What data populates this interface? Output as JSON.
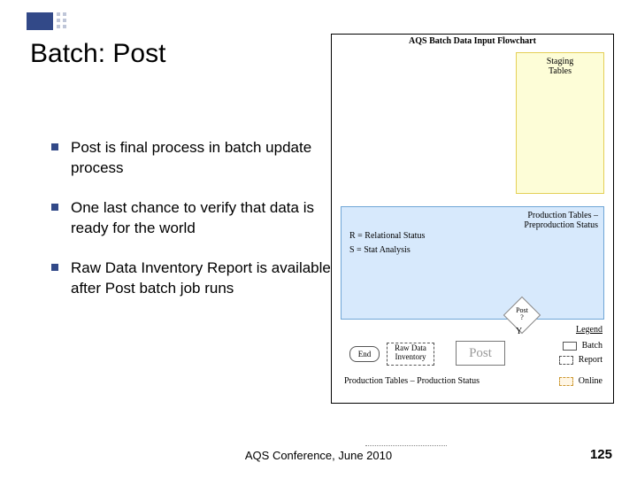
{
  "title": "Batch: Post",
  "bullets": [
    "Post is final process in batch update process",
    "One last chance to verify that data is ready for the world",
    "Raw Data Inventory Report is available after Post batch job runs"
  ],
  "footer": {
    "left": "AQS Conference, June 2010",
    "right": "125"
  },
  "flowchart": {
    "title": "AQS Batch Data Input Flowchart",
    "staging": "Staging\nTables",
    "prod_pre": "Production Tables –\nPreproduction Status",
    "r_label": "R = Relational Status",
    "s_label": "S = Stat Analysis",
    "diamond": "Post\n?",
    "y_label": "Y",
    "end": "End",
    "rdi": "Raw Data\nInventory",
    "post": "Post",
    "prod_status": "Production Tables – Production Status",
    "legend": {
      "title": "Legend",
      "batch": "Batch",
      "report": "Report",
      "online": "Online"
    }
  }
}
